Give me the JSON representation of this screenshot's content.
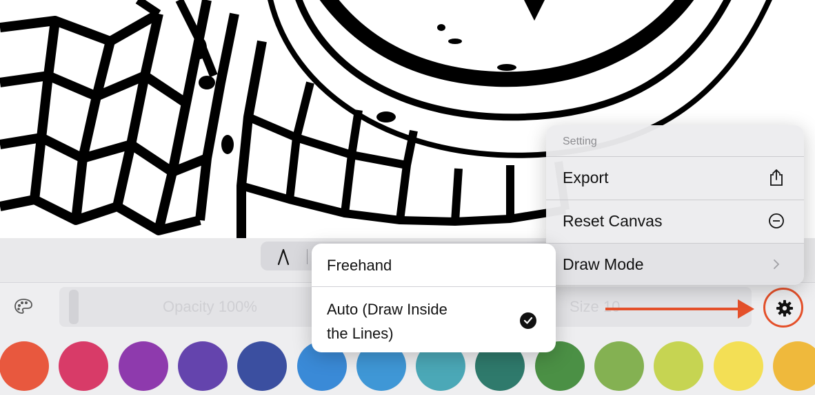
{
  "toolbar": {
    "opacity_label": "Opacity 100%",
    "size_label": "Size 10",
    "icons": {
      "pen": "pen-nib-icon",
      "palette": "palette-icon",
      "settings": "gear-icon"
    }
  },
  "settings_menu": {
    "header": "Setting",
    "items": [
      {
        "label": "Export",
        "icon": "share-icon"
      },
      {
        "label": "Reset Canvas",
        "icon": "minus-circle-icon"
      },
      {
        "label": "Draw Mode",
        "icon": "chevron-right-icon"
      }
    ]
  },
  "draw_mode_submenu": {
    "options": [
      {
        "label": "Freehand",
        "selected": false
      },
      {
        "label_line1": "Auto (Draw Inside",
        "label_line2": "the Lines)",
        "selected": true
      }
    ]
  },
  "colors": [
    "#e8583e",
    "#d83b68",
    "#8e3aad",
    "#6444ad",
    "#3b4fa0",
    "#3a8ad7",
    "#3f97d6",
    "#4ba8b7",
    "#2f7a6c",
    "#4b9045",
    "#84b152",
    "#c6d452",
    "#f3df55",
    "#efb93c"
  ],
  "annotation_color": "#e4502a"
}
